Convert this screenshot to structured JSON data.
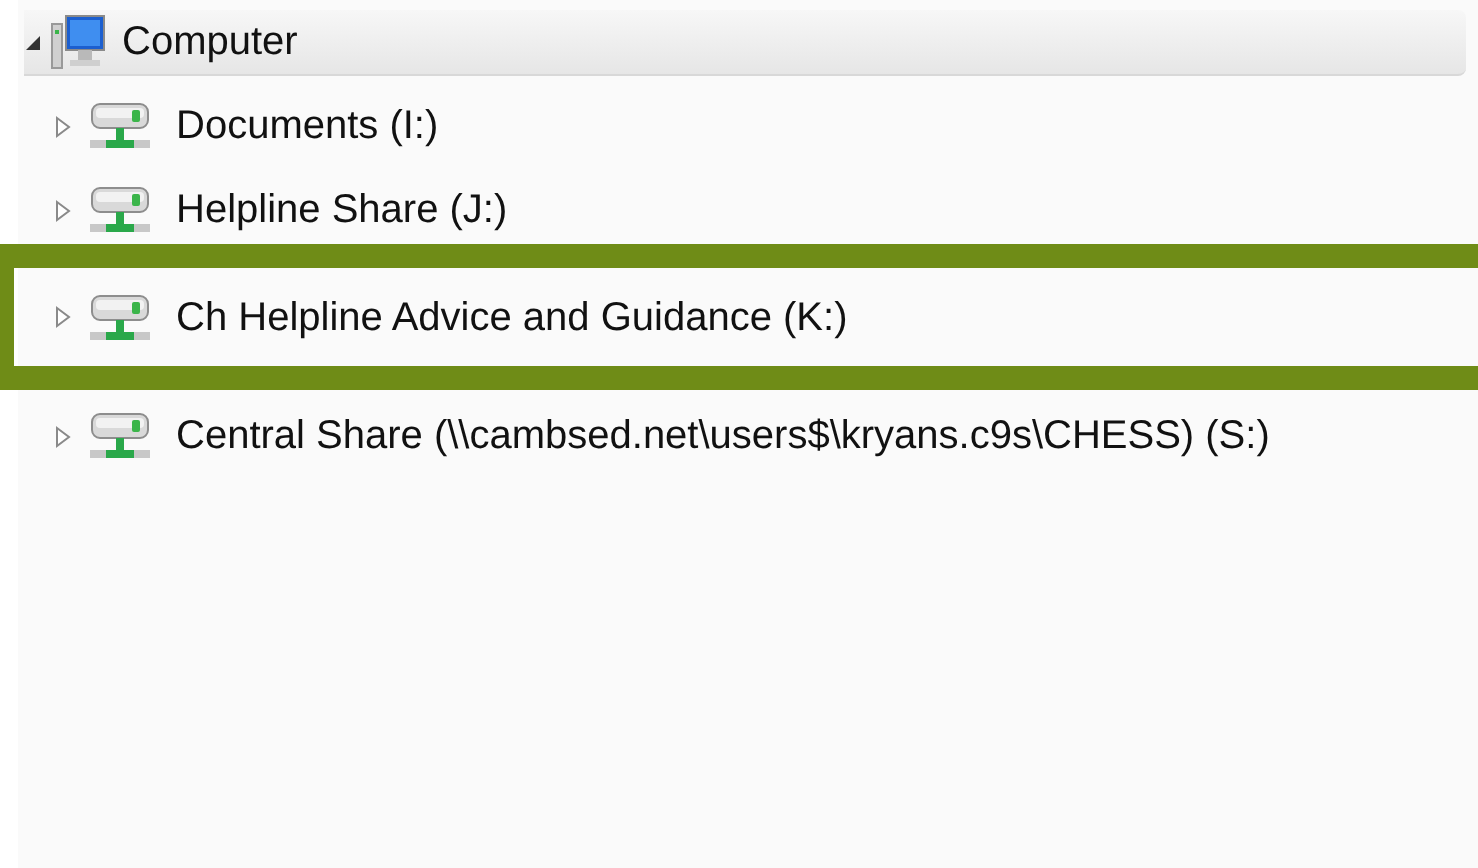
{
  "tree": {
    "label": "Computer",
    "expanded": true,
    "children": [
      {
        "label": "Documents (I:)",
        "expanded": false,
        "highlighted": false
      },
      {
        "label": "Helpline Share (J:)",
        "expanded": false,
        "highlighted": false
      },
      {
        "label": "Ch Helpline Advice and Guidance (K:)",
        "expanded": false,
        "highlighted": true
      },
      {
        "label": "Central Share (\\\\cambsed.net\\users$\\kryans.c9s\\CHESS) (S:)",
        "expanded": false,
        "highlighted": false
      }
    ]
  }
}
